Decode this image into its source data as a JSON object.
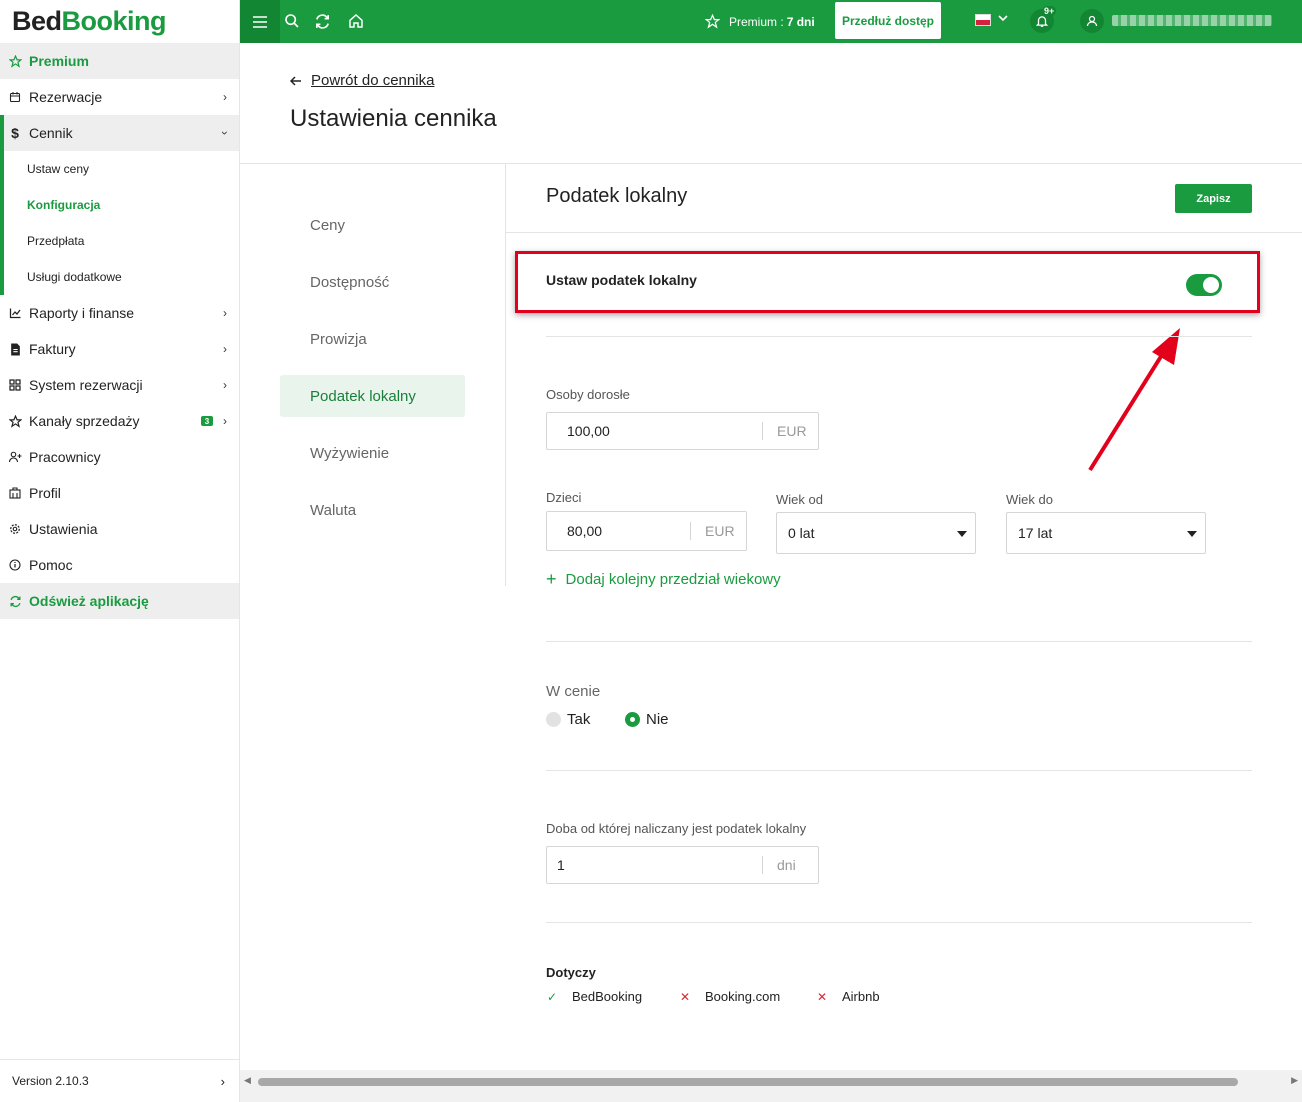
{
  "brand": {
    "part1": "Bed",
    "part2": "Booking",
    "accent": "#1a9b40",
    "highlight": "#e3001b"
  },
  "sidebar": {
    "premium": "Premium",
    "items": [
      {
        "label": "Rezerwacje",
        "icon": "calendar-icon"
      },
      {
        "label": "Cennik",
        "icon": "dollar-icon"
      },
      {
        "label": "Raporty i finanse",
        "icon": "chart-icon"
      },
      {
        "label": "Faktury",
        "icon": "invoice-icon"
      },
      {
        "label": "System rezerwacji",
        "icon": "grid-icon"
      },
      {
        "label": "Kanały sprzedaży",
        "icon": "star-icon",
        "badge": "3"
      },
      {
        "label": "Pracownicy",
        "icon": "user-plus-icon"
      },
      {
        "label": "Profil",
        "icon": "building-icon"
      },
      {
        "label": "Ustawienia",
        "icon": "gear-icon"
      },
      {
        "label": "Pomoc",
        "icon": "info-icon"
      }
    ],
    "cennik_sub": [
      "Ustaw ceny",
      "Konfiguracja",
      "Przedpłata",
      "Usługi dodatkowe"
    ],
    "refresh": "Odśwież aplikację",
    "version": "Version 2.10.3"
  },
  "topbar": {
    "premium_label": "Premium :",
    "premium_days": "7 dni",
    "extend_button": "Przedłuż dostęp",
    "notifications": "9+"
  },
  "header": {
    "back_link": "Powrót do cennika",
    "title": "Ustawienia cennika"
  },
  "settings_menu": [
    "Ceny",
    "Dostępność",
    "Prowizja",
    "Podatek lokalny",
    "Wyżywienie",
    "Waluta"
  ],
  "panel": {
    "title": "Podatek lokalny",
    "save_button": "Zapisz",
    "toggle_label": "Ustaw podatek lokalny",
    "toggle_on": true,
    "adults": {
      "label": "Osoby dorosłe",
      "value": "100,00",
      "unit": "EUR"
    },
    "children": {
      "label": "Dzieci",
      "value": "80,00",
      "unit": "EUR",
      "age_from_label": "Wiek od",
      "age_from": "0 lat",
      "age_to_label": "Wiek do",
      "age_to": "17 lat"
    },
    "add_age_range": "Dodaj kolejny przedział wiekowy",
    "included": {
      "label": "W cenie",
      "yes": "Tak",
      "no": "Nie",
      "selected": "Nie"
    },
    "night": {
      "label": "Doba od której naliczany jest podatek lokalny",
      "value": "1",
      "unit": "dni"
    },
    "applies": {
      "label": "Dotyczy",
      "items": [
        {
          "name": "BedBooking",
          "enabled": true
        },
        {
          "name": "Booking.com",
          "enabled": false
        },
        {
          "name": "Airbnb",
          "enabled": false
        }
      ]
    }
  }
}
